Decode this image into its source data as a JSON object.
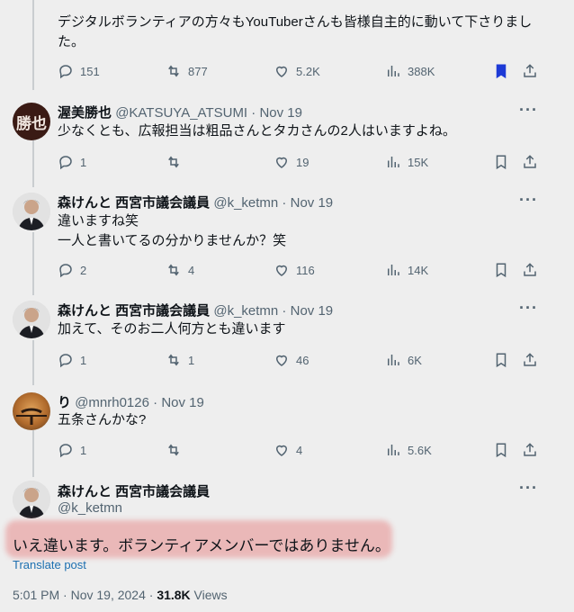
{
  "tweets": [
    {
      "body": "デジタルボランティアの方々もYouTuberさんも皆様自主的に動いて下さりました。",
      "replies": "151",
      "retweets": "877",
      "likes": "5.2K",
      "views": "388K",
      "bookmarked": true
    },
    {
      "avatar": "勝也",
      "name": "渥美勝也",
      "handle": "@KATSUYA_ATSUMI",
      "date": "Nov 19",
      "body": "少なくとも、広報担当は粗品さんとタカさんの2人はいますよね。",
      "replies": "1",
      "retweets": "",
      "likes": "19",
      "views": "15K",
      "bookmarked": false
    },
    {
      "name": "森けんと 西宮市議会議員",
      "handle": "@k_ketmn",
      "date": "Nov 19",
      "body": "違いますね笑",
      "body2": "一人と書いてるの分かりませんか？笑",
      "replies": "2",
      "retweets": "4",
      "likes": "116",
      "views": "14K",
      "bookmarked": false
    },
    {
      "name": "森けんと 西宮市議会議員",
      "handle": "@k_ketmn",
      "date": "Nov 19",
      "body": "加えて、そのお二人何方とも違います",
      "replies": "1",
      "retweets": "1",
      "likes": "46",
      "views": "6K",
      "bookmarked": false
    },
    {
      "name": "り",
      "handle": "@mnrh0126",
      "date": "Nov 19",
      "body": "五条さんかな?",
      "replies": "1",
      "retweets": "",
      "likes": "4",
      "views": "5.6K",
      "bookmarked": false
    }
  ],
  "main": {
    "name": "森けんと 西宮市議会議員",
    "handle": "@k_ketmn",
    "text": "いえ違います。ボランティアメンバーではありません。",
    "translate": "Translate post",
    "time": "5:01 PM · Nov 19, 2024 · ",
    "views_count": "31.8K",
    "views_label": " Views"
  },
  "dots": "···",
  "sep": " · "
}
